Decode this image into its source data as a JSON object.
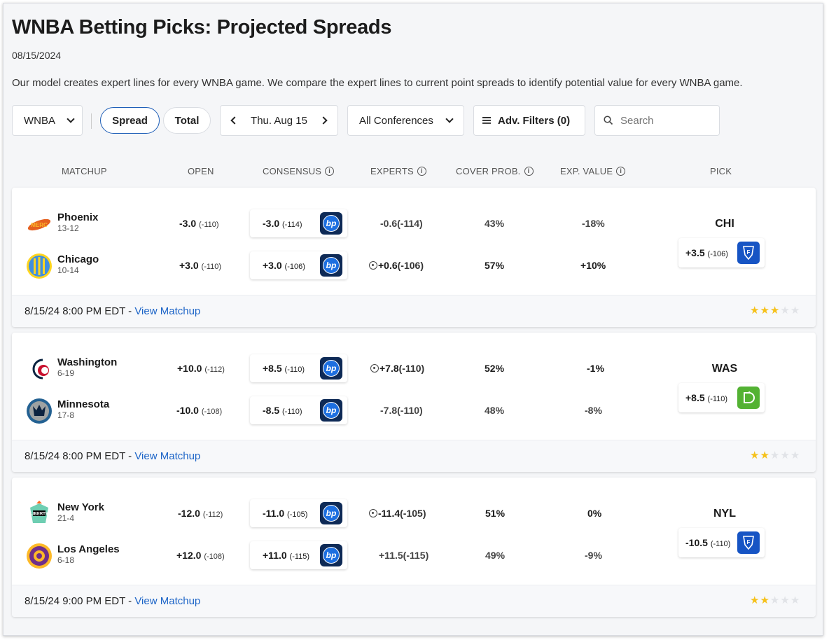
{
  "page": {
    "title": "WNBA Betting Picks: Projected Spreads",
    "date": "08/15/2024",
    "description": "Our model creates expert lines for every WNBA game. We compare the expert lines to current point spreads to identify potential value for every WNBA game."
  },
  "toolbar": {
    "league": "WNBA",
    "spread": "Spread",
    "total": "Total",
    "date": "Thu. Aug 15",
    "conferences": "All Conferences",
    "filters": "Adv. Filters (0)",
    "search_placeholder": "Search"
  },
  "columns": {
    "matchup": "MATCHUP",
    "open": "OPEN",
    "consensus": "CONSENSUS",
    "experts": "EXPERTS",
    "cover": "COVER PROB.",
    "exp_value": "EXP. VALUE",
    "pick": "PICK"
  },
  "colors": {
    "accent": "#1c64c7",
    "star_on": "#f5c11b",
    "fanduel": "#1654c4",
    "draftkings": "#53b233",
    "betprofit": "#0e2a56"
  },
  "games": [
    {
      "teams": [
        {
          "name": "Phoenix",
          "record": "13-12",
          "open": "-3.0",
          "open_odds": "(-110)",
          "consensus": "-3.0",
          "consensus_odds": "(-114)",
          "experts": "-0.6",
          "experts_odds": "(-114)",
          "expert_target": false,
          "cover": "43%",
          "ev": "-18%"
        },
        {
          "name": "Chicago",
          "record": "10-14",
          "open": "+3.0",
          "open_odds": "(-110)",
          "consensus": "+3.0",
          "consensus_odds": "(-106)",
          "experts": "+0.6",
          "experts_odds": "(-106)",
          "expert_target": true,
          "cover": "57%",
          "ev": "+10%"
        }
      ],
      "pick": {
        "team": "CHI",
        "line": "+3.5",
        "odds": "(-106)",
        "book": "fanduel-icon"
      },
      "time": "8/15/24 8:00 PM EDT",
      "separator": "-",
      "link": "View Matchup",
      "stars": 3
    },
    {
      "teams": [
        {
          "name": "Washington",
          "record": "6-19",
          "open": "+10.0",
          "open_odds": "(-112)",
          "consensus": "+8.5",
          "consensus_odds": "(-110)",
          "experts": "+7.8",
          "experts_odds": "(-110)",
          "expert_target": true,
          "cover": "52%",
          "ev": "-1%"
        },
        {
          "name": "Minnesota",
          "record": "17-8",
          "open": "-10.0",
          "open_odds": "(-108)",
          "consensus": "-8.5",
          "consensus_odds": "(-110)",
          "experts": "-7.8",
          "experts_odds": "(-110)",
          "expert_target": false,
          "cover": "48%",
          "ev": "-8%"
        }
      ],
      "pick": {
        "team": "WAS",
        "line": "+8.5",
        "odds": "(-110)",
        "book": "draftkings-icon"
      },
      "time": "8/15/24 8:00 PM EDT",
      "separator": "-",
      "link": "View Matchup",
      "stars": 2
    },
    {
      "teams": [
        {
          "name": "New York",
          "record": "21-4",
          "open": "-12.0",
          "open_odds": "(-112)",
          "consensus": "-11.0",
          "consensus_odds": "(-105)",
          "experts": "-11.4",
          "experts_odds": "(-105)",
          "expert_target": true,
          "cover": "51%",
          "ev": "0%"
        },
        {
          "name": "Los Angeles",
          "record": "6-18",
          "open": "+12.0",
          "open_odds": "(-108)",
          "consensus": "+11.0",
          "consensus_odds": "(-115)",
          "experts": "+11.5",
          "experts_odds": "(-115)",
          "expert_target": false,
          "cover": "49%",
          "ev": "-9%"
        }
      ],
      "pick": {
        "team": "NYL",
        "line": "-10.5",
        "odds": "(-110)",
        "book": "fanduel-icon"
      },
      "time": "8/15/24 9:00 PM EDT",
      "separator": "-",
      "link": "View Matchup",
      "stars": 2
    }
  ]
}
